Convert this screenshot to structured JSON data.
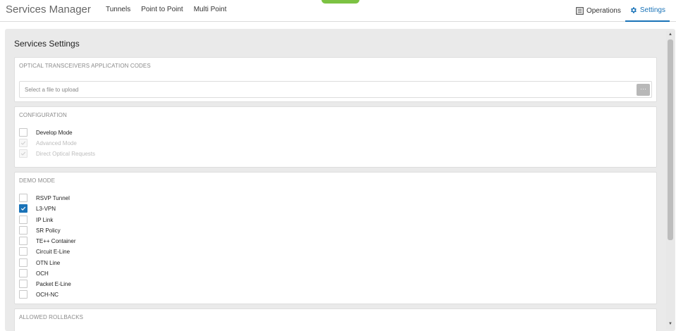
{
  "header": {
    "app_title": "Services Manager",
    "nav": [
      "Tunnels",
      "Point to Point",
      "Multi Point"
    ],
    "right_nav": {
      "operations": "Operations",
      "settings": "Settings"
    }
  },
  "page": {
    "title": "Services Settings"
  },
  "optical": {
    "header": "OPTICAL TRANSCEIVERS APPLICATION CODES",
    "placeholder": "Select a file to upload",
    "browse_label": "···"
  },
  "configuration": {
    "header": "CONFIGURATION",
    "items": [
      {
        "label": "Develop Mode",
        "checked": false,
        "disabled": false
      },
      {
        "label": "Advanced Mode",
        "checked": true,
        "disabled": true
      },
      {
        "label": "Direct Optical Requests",
        "checked": true,
        "disabled": true
      }
    ]
  },
  "demo_mode": {
    "header": "DEMO MODE",
    "items": [
      {
        "label": "RSVP Tunnel",
        "checked": false
      },
      {
        "label": "L3-VPN",
        "checked": true
      },
      {
        "label": "IP Link",
        "checked": false
      },
      {
        "label": "SR Policy",
        "checked": false
      },
      {
        "label": "TE++ Container",
        "checked": false
      },
      {
        "label": "Circuit E-Line",
        "checked": false
      },
      {
        "label": "OTN Line",
        "checked": false
      },
      {
        "label": "OCH",
        "checked": false
      },
      {
        "label": "Packet E-Line",
        "checked": false
      },
      {
        "label": "OCH-NC",
        "checked": false
      }
    ]
  },
  "allowed_rollbacks": {
    "header": "ALLOWED ROLLBACKS"
  },
  "colors": {
    "accent": "#1a73b8",
    "status_pill": "#7cc243"
  }
}
